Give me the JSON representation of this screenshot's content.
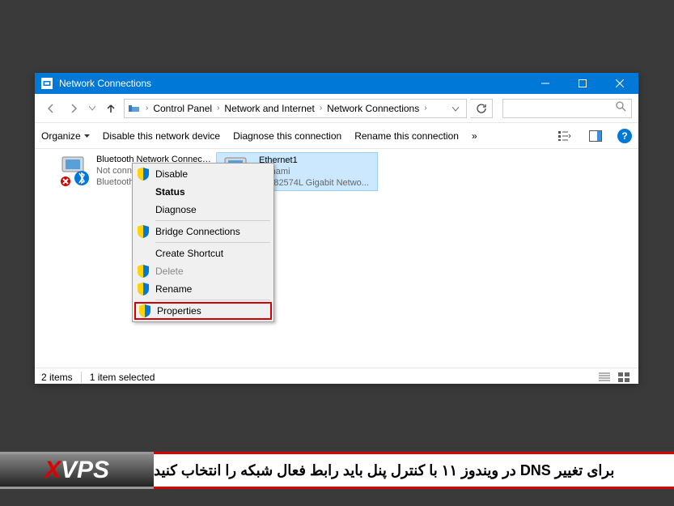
{
  "window": {
    "title": "Network Connections"
  },
  "breadcrumbs": {
    "items": [
      "Control Panel",
      "Network and Internet",
      "Network Connections"
    ]
  },
  "toolbar": {
    "organize": "Organize",
    "disable": "Disable this network device",
    "diagnose": "Diagnose this connection",
    "rename": "Rename this connection",
    "overflow": "»"
  },
  "adapters": [
    {
      "name": "Bluetooth Network Connection",
      "status": "Not connected",
      "device": "Bluetooth"
    },
    {
      "name": "Ethernet1",
      "status": "tsunami",
      "device": "(R) 82574L Gigabit Netwo..."
    }
  ],
  "context_menu": {
    "disable": "Disable",
    "status": "Status",
    "diagnose": "Diagnose",
    "bridge": "Bridge Connections",
    "shortcut": "Create Shortcut",
    "delete": "Delete",
    "rename": "Rename",
    "properties": "Properties"
  },
  "status": {
    "items": "2 items",
    "selected": "1 item selected"
  },
  "banner": {
    "logo_x": "X",
    "logo_vps": "VPS",
    "text": "برای تغییر DNS در ویندوز ۱۱ با کنترل پنل باید رابط فعال شبکه را انتخاب کنید"
  },
  "help": "?"
}
